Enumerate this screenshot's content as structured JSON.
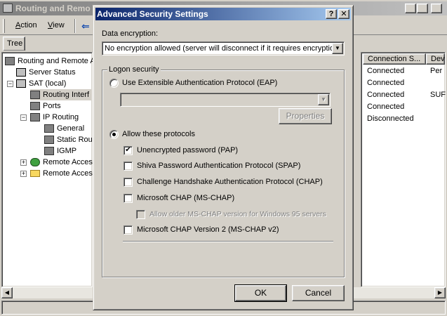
{
  "bg_window": {
    "title": "Routing and Remo",
    "menu": [
      {
        "label": "Action",
        "accel": "A",
        "rest": "ction"
      },
      {
        "label": "View",
        "accel": "V",
        "rest": "iew"
      }
    ],
    "tab_tree": "Tree",
    "tree": [
      {
        "label": "Routing and Remote A",
        "icon": "computer-icon"
      },
      {
        "label": "Server Status",
        "icon": "server-icon"
      },
      {
        "label": "SAT (local)",
        "icon": "server-icon"
      },
      {
        "label": "Routing Interf",
        "icon": "network-icon"
      },
      {
        "label": "Ports",
        "icon": "network-icon"
      },
      {
        "label": "IP Routing",
        "icon": "network-icon"
      },
      {
        "label": "General",
        "icon": "network-icon"
      },
      {
        "label": "Static Rou",
        "icon": "network-icon"
      },
      {
        "label": "IGMP",
        "icon": "network-icon"
      },
      {
        "label": "Remote Acces",
        "icon": "policy-icon"
      },
      {
        "label": "Remote Acces",
        "icon": "folder-icon"
      }
    ],
    "columns": [
      "Connection S...",
      "Dev"
    ],
    "rows": [
      {
        "status": "Connected",
        "dev": "Per"
      },
      {
        "status": "Connected",
        "dev": ""
      },
      {
        "status": "Connected",
        "dev": "SUF"
      },
      {
        "status": "Connected",
        "dev": ""
      },
      {
        "status": "Disconnected",
        "dev": ""
      }
    ]
  },
  "dialog": {
    "title": "Advanced Security Settings",
    "help_glyph": "?",
    "close_glyph": "✕",
    "data_encryption_label": "Data encryption:",
    "data_encryption_value": "No encryption allowed (server will disconnect if it requires encryption)",
    "logon_security_label": "Logon security",
    "eap_radio_label": "Use Extensible Authentication Protocol (EAP)",
    "eap_selected": false,
    "eap_combo_value": "",
    "properties_label": "Properties",
    "allow_radio_label": "Allow these protocols",
    "allow_selected": true,
    "protocols": [
      {
        "label": "Unencrypted password (PAP)",
        "checked": true,
        "enabled": true
      },
      {
        "label": "Shiva Password Authentication Protocol (SPAP)",
        "checked": false,
        "enabled": true
      },
      {
        "label": "Challenge Handshake Authentication Protocol (CHAP)",
        "checked": false,
        "enabled": true
      },
      {
        "label": "Microsoft CHAP (MS-CHAP)",
        "checked": false,
        "enabled": true
      },
      {
        "label": "Allow older MS-CHAP version for Windows 95 servers",
        "checked": false,
        "enabled": false
      },
      {
        "label": "Microsoft CHAP Version 2 (MS-CHAP v2)",
        "checked": false,
        "enabled": true
      }
    ],
    "ok_label": "OK",
    "cancel_label": "Cancel"
  },
  "colors": {
    "dialog_title_start": "#0a246a",
    "dialog_title_end": "#a6caf0",
    "face": "#d4d0c8"
  }
}
